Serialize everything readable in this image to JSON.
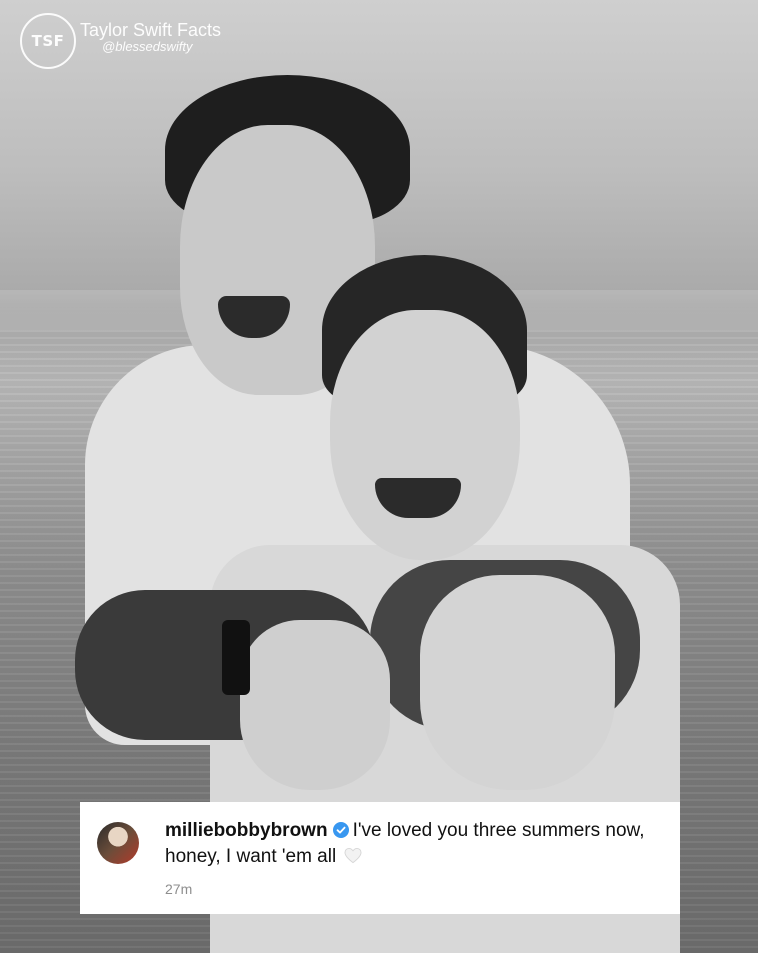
{
  "watermark": {
    "logo_text": "TSF",
    "name": "Taylor Swift Facts",
    "handle": "@blessedswifty"
  },
  "caption": {
    "username": "milliebobbybrown",
    "verified": true,
    "text_line1": "I've loved you three summers now,",
    "text_line2": "honey, I want 'em all",
    "emoji": "white-heart",
    "timestamp": "27m"
  },
  "colors": {
    "verified_badge": "#3897f0",
    "card_background": "#ffffff",
    "timestamp_gray": "#8e8e8e"
  }
}
